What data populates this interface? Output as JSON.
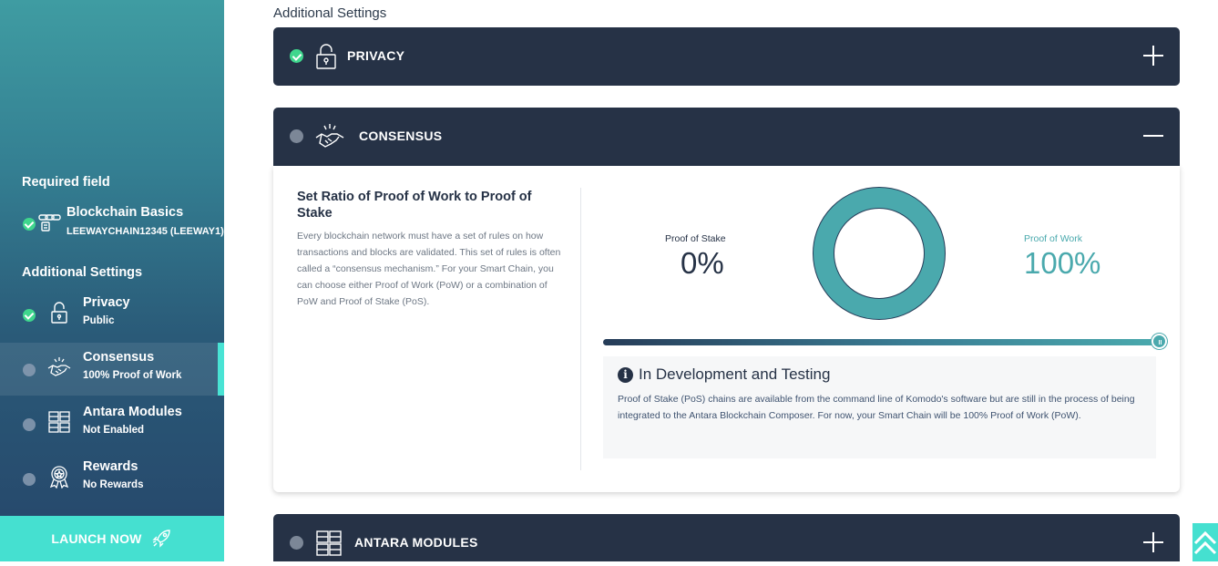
{
  "sidebar": {
    "required_heading": "Required field",
    "additional_heading": "Additional Settings",
    "items": [
      {
        "title": "Blockchain Basics",
        "sub": "LEEWAYCHAIN12345 (LEEWAY1)",
        "icon": "chain-links-icon",
        "status": "done"
      },
      {
        "title": "Privacy",
        "sub": "Public",
        "icon": "padlock-icon",
        "status": "done"
      },
      {
        "title": "Consensus",
        "sub": "100% Proof of Work",
        "icon": "handshake-icon",
        "status": "pending",
        "active": true
      },
      {
        "title": "Antara Modules",
        "sub": "Not Enabled",
        "icon": "modules-cubes-icon",
        "status": "pending"
      },
      {
        "title": "Rewards",
        "sub": "No Rewards",
        "icon": "award-badge-icon",
        "status": "pending"
      }
    ],
    "launch_label": "LAUNCH NOW",
    "launch_icon": "rocket-icon"
  },
  "main": {
    "title": "Additional Settings",
    "panels": [
      {
        "label": "PRIVACY",
        "icon": "padlock-icon",
        "status": "done",
        "expanded": false
      },
      {
        "label": "CONSENSUS",
        "icon": "handshake-icon",
        "status": "pending",
        "expanded": true
      },
      {
        "label": "ANTARA MODULES",
        "icon": "modules-cubes-icon",
        "status": "pending",
        "expanded": false
      }
    ],
    "consensus": {
      "heading": "Set Ratio of Proof of Work to Proof of Stake",
      "description": "Every blockchain network must have a set of rules on how transactions and blocks are validated. This set of rules is often called a “consensus mechanism.” For your Smart Chain, you can choose either Proof of Work (PoW) or a combination of PoW and Proof of Stake (PoS).",
      "pos_label": "Proof of Stake",
      "pos_value": "0%",
      "pow_label": "Proof of Work",
      "pow_value": "100%",
      "pow_fraction": 1.0,
      "info_title": "In Development and Testing",
      "info_text": "Proof of Stake (PoS) chains are available from the command line of Komodo's software but are still in the process of being integrated to the Antara Blockchain Composer. For now, your Smart Chain will be 100% Proof of Work (PoW)."
    }
  },
  "colors": {
    "accent": "#45e0d0",
    "panel_header": "#263246",
    "teal": "#4aa9ad",
    "success": "#3fd68d"
  }
}
